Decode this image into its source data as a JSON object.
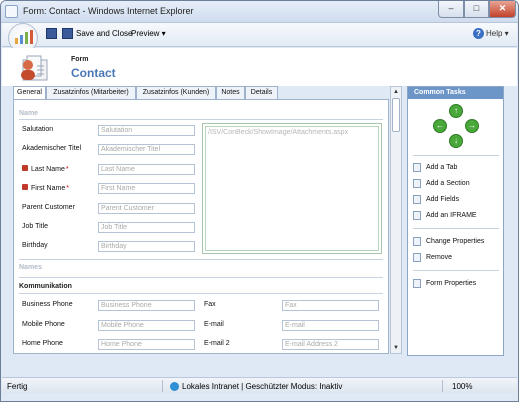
{
  "window": {
    "title": "Form: Contact - Windows Internet Explorer",
    "min": "–",
    "max": "□",
    "close": "✕"
  },
  "toolbar": {
    "save_close": "Save and Close",
    "preview": "Preview ▾",
    "help": "Help ▾"
  },
  "header": {
    "small": "Form",
    "big": "Contact"
  },
  "tabs": [
    {
      "label": "General",
      "active": true
    },
    {
      "label": "Zusatzinfos (Mitarbeiter)"
    },
    {
      "label": "Zusatzinfos (Kunden)"
    },
    {
      "label": "Notes"
    },
    {
      "label": "Details"
    }
  ],
  "form": {
    "section_name": "Name",
    "section_names": "Names",
    "section_komm": "Kommunikation",
    "fields": [
      {
        "label": "Salutation",
        "placeholder": "Salutation"
      },
      {
        "label": "Akademischer Titel",
        "placeholder": "Akademischer Titel"
      },
      {
        "label": "Last Name",
        "placeholder": "Last Name",
        "required": "*"
      },
      {
        "label": "First Name",
        "placeholder": "First Name",
        "required": "*"
      },
      {
        "label": "Parent Customer",
        "placeholder": "Parent Customer"
      },
      {
        "label": "Job Title",
        "placeholder": "Job Title"
      },
      {
        "label": "Birthday",
        "placeholder": "Birthday"
      }
    ],
    "iframe_url": "/ISV/ConBeck/ShowImage/Attachments.aspx",
    "komm": [
      {
        "label": "Business Phone",
        "placeholder": "Business Phone",
        "label2": "Fax",
        "placeholder2": "Fax"
      },
      {
        "label": "Mobile Phone",
        "placeholder": "Mobile Phone",
        "label2": "E-mail",
        "placeholder2": "E-mail"
      },
      {
        "label": "Home Phone",
        "placeholder": "Home Phone",
        "label2": "E-mail 2",
        "placeholder2": "E-mail Address 2"
      }
    ]
  },
  "tasks": {
    "title": "Common Tasks",
    "items": [
      "Add a Tab",
      "Add a Section",
      "Add Fields",
      "Add an IFRAME",
      "Change Properties",
      "Remove",
      "Form Properties"
    ]
  },
  "status": {
    "left": "Fertig",
    "zone": "Lokales Intranet | Geschützter Modus: Inaktiv",
    "zoom": "100%"
  }
}
